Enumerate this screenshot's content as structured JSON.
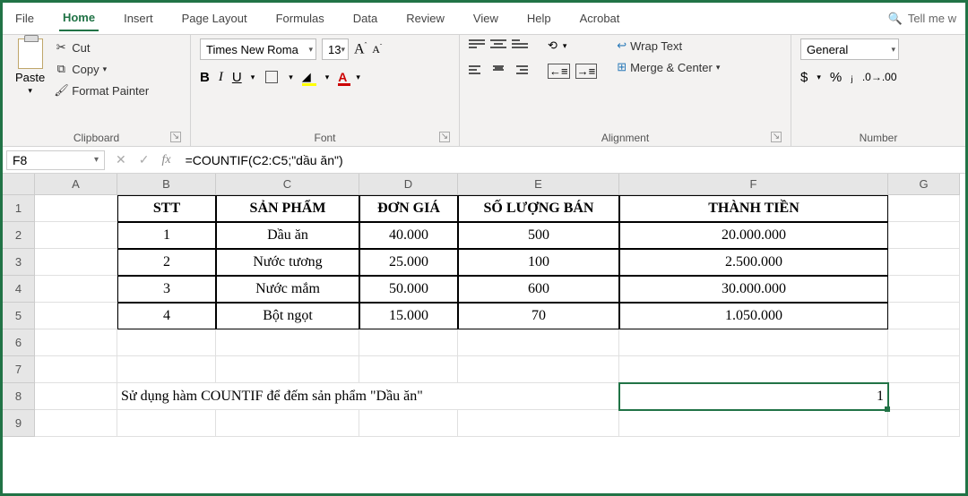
{
  "tabs": {
    "file": "File",
    "home": "Home",
    "insert": "Insert",
    "pagelayout": "Page Layout",
    "formulas": "Formulas",
    "data": "Data",
    "review": "Review",
    "view": "View",
    "help": "Help",
    "acrobat": "Acrobat",
    "tellme": "Tell me w"
  },
  "ribbon": {
    "clipboard": {
      "label": "Clipboard",
      "paste": "Paste",
      "cut": "Cut",
      "copy": "Copy",
      "fmt": "Format Painter"
    },
    "font": {
      "label": "Font",
      "name": "Times New Roma",
      "size": "13"
    },
    "alignment": {
      "label": "Alignment",
      "wrap": "Wrap Text",
      "merge": "Merge & Center"
    },
    "number": {
      "label": "Number",
      "format": "General"
    }
  },
  "formula_bar": {
    "namebox": "F8",
    "formula": "=COUNTIF(C2:C5;\"dầu ăn\")"
  },
  "columns": [
    "A",
    "B",
    "C",
    "D",
    "E",
    "F",
    "G"
  ],
  "row_numbers": [
    "1",
    "2",
    "3",
    "4",
    "5",
    "6",
    "7",
    "8",
    "9"
  ],
  "table": {
    "headers": {
      "b": "STT",
      "c": "SẢN PHẨM",
      "d": "ĐƠN GIÁ",
      "e": "SỐ LƯỢNG BÁN",
      "f": "THÀNH TIỀN"
    },
    "rows": [
      {
        "b": "1",
        "c": "Dầu ăn",
        "d": "40.000",
        "e": "500",
        "f": "20.000.000"
      },
      {
        "b": "2",
        "c": "Nước tương",
        "d": "25.000",
        "e": "100",
        "f": "2.500.000"
      },
      {
        "b": "3",
        "c": "Nước mắm",
        "d": "50.000",
        "e": "600",
        "f": "30.000.000"
      },
      {
        "b": "4",
        "c": "Bột ngọt",
        "d": "15.000",
        "e": "70",
        "f": "1.050.000"
      }
    ]
  },
  "row8": {
    "text": "Sử dụng hàm COUNTIF để đếm sản phẩm \"Dầu ăn\"",
    "result": "1"
  }
}
